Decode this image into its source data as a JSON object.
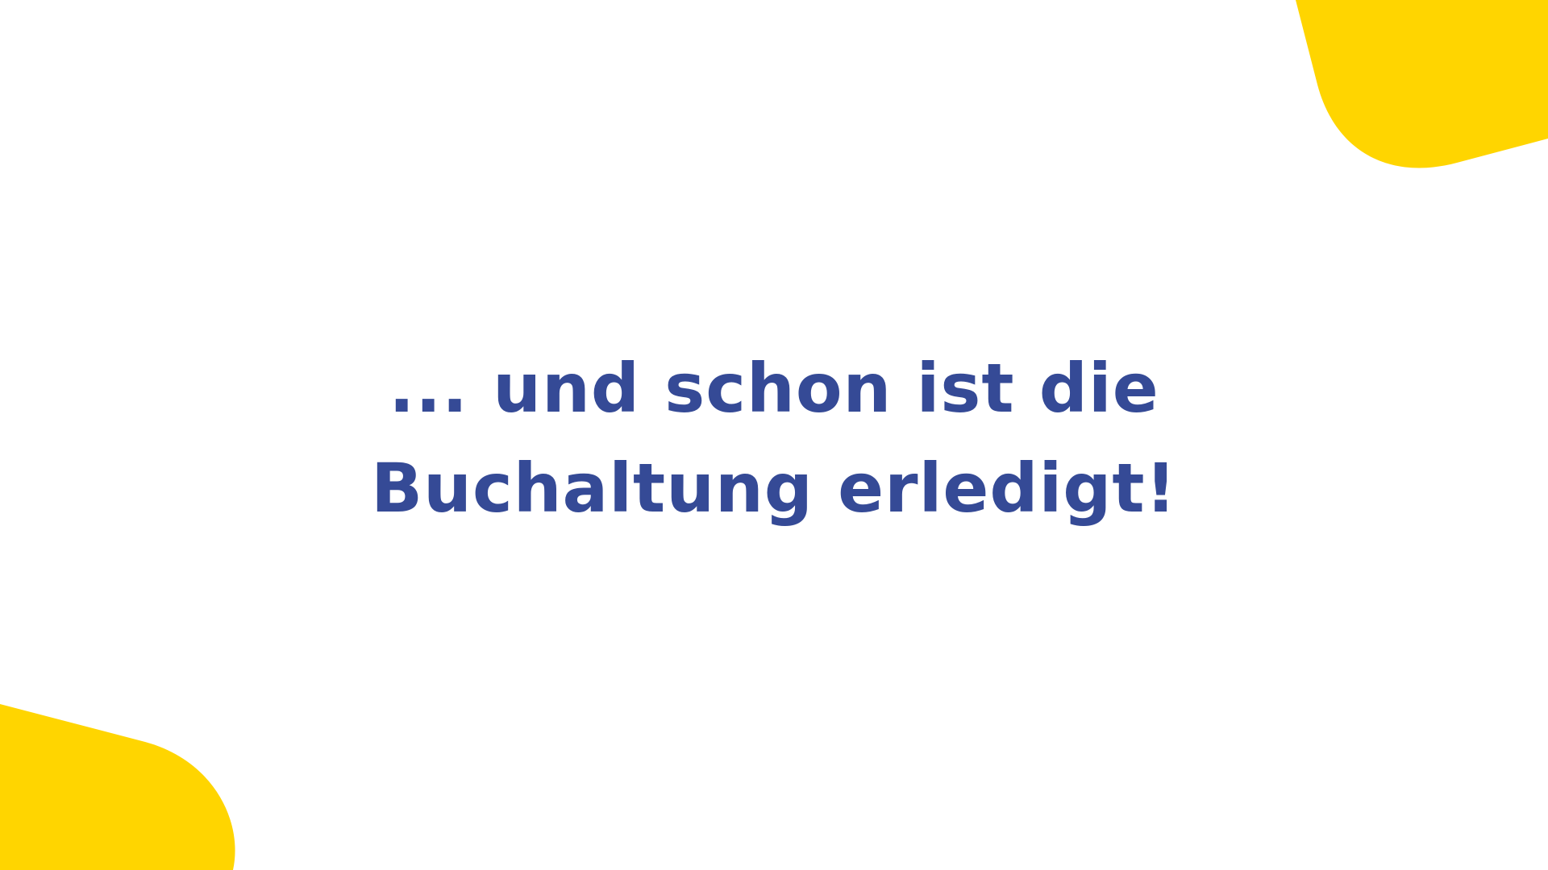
{
  "slide": {
    "headline_line_1": "... und schon ist die",
    "headline_line_2": "Buchaltung erledigt!"
  },
  "colors": {
    "background": "#FFFFFF",
    "text": "#354A96",
    "accent": "#FFD500"
  }
}
